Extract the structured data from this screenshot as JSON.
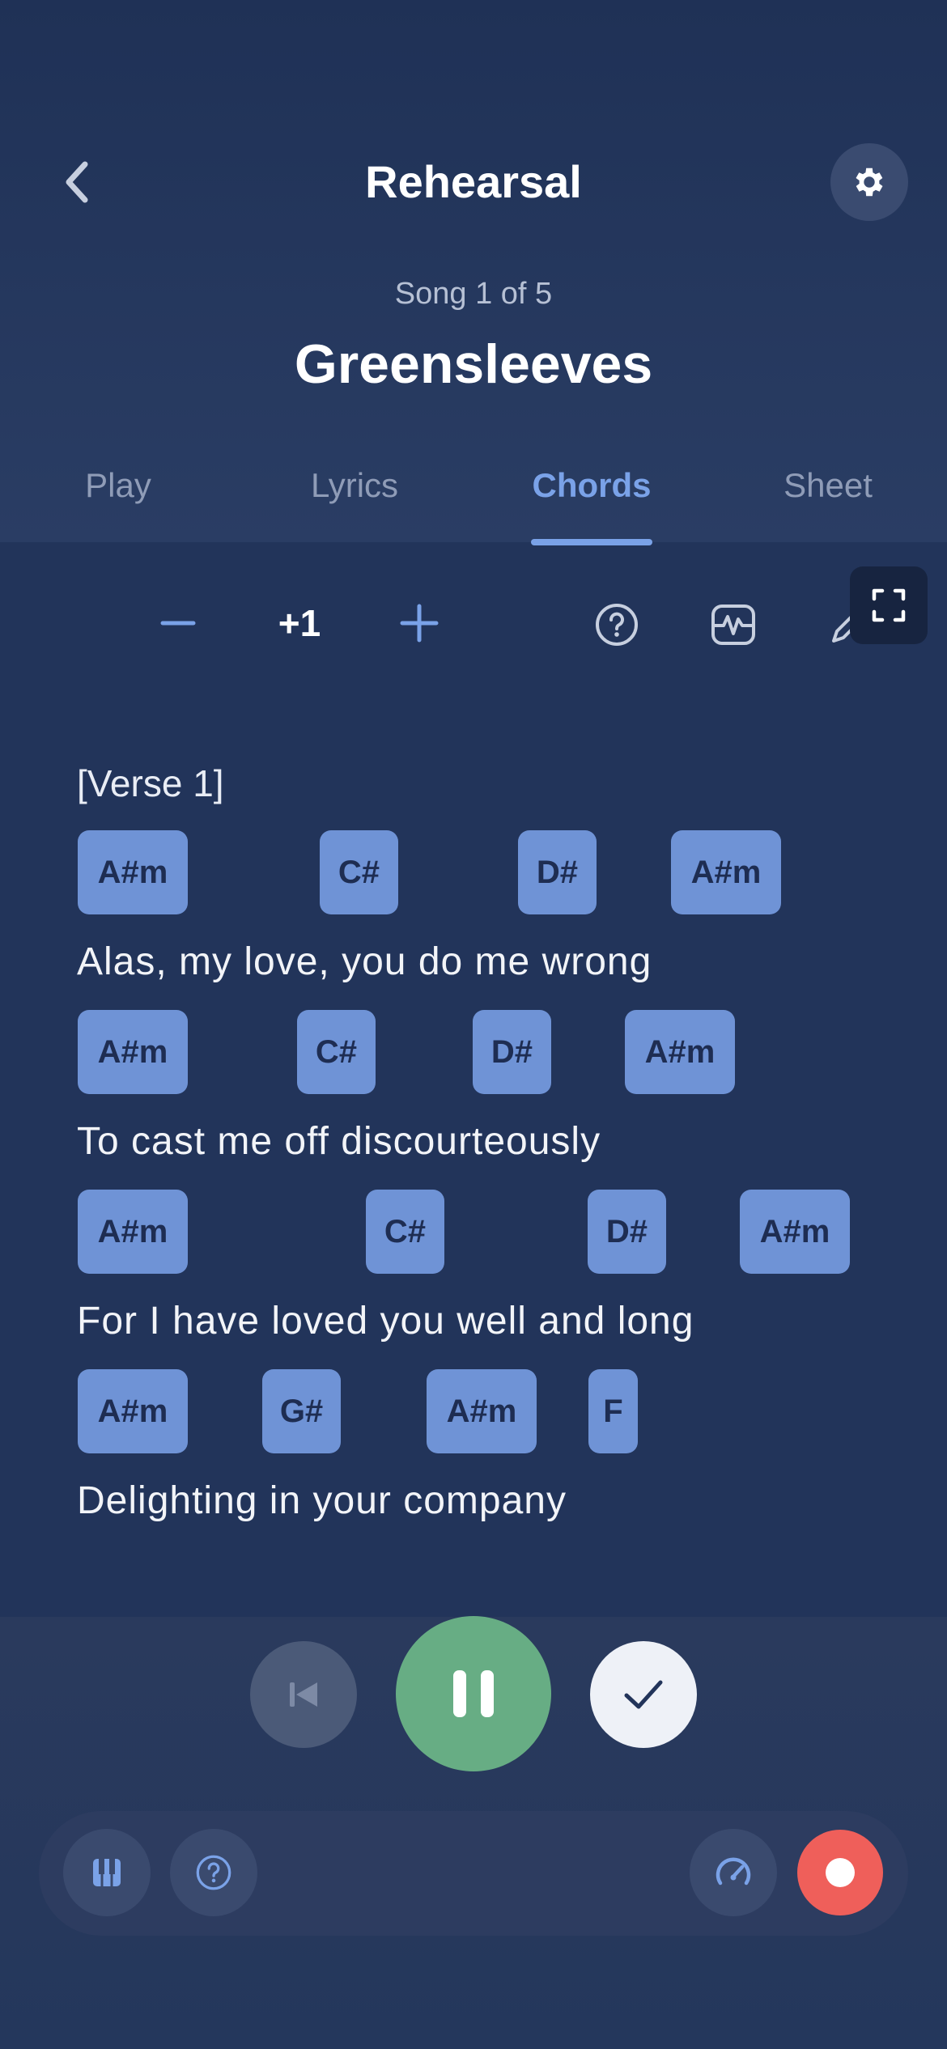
{
  "header": {
    "title": "Rehearsal",
    "song_counter": "Song 1 of 5",
    "song_title": "Greensleeves"
  },
  "tabs": [
    {
      "label": "Play",
      "active": false
    },
    {
      "label": "Lyrics",
      "active": false
    },
    {
      "label": "Chords",
      "active": true
    },
    {
      "label": "Sheet",
      "active": false
    }
  ],
  "toolbar": {
    "transpose_value": "+1",
    "icons": [
      "minus-icon",
      "plus-icon",
      "help-icon",
      "waveform-icon",
      "pencil-icon",
      "fullscreen-icon"
    ]
  },
  "song": {
    "section": "[Verse 1]",
    "lines": [
      {
        "lyric": "Alas, my love, you do me wrong",
        "chords": [
          "A#m",
          "C#",
          "D#",
          "A#m"
        ]
      },
      {
        "lyric": "To cast me off discourteously",
        "chords": [
          "A#m",
          "C#",
          "D#",
          "A#m"
        ]
      },
      {
        "lyric": "For I have loved you well and long",
        "chords": [
          "A#m",
          "C#",
          "D#",
          "A#m"
        ]
      },
      {
        "lyric": "Delighting in your company",
        "chords": [
          "A#m",
          "G#",
          "A#m",
          "F"
        ]
      }
    ]
  },
  "player": {
    "controls": [
      "skip-back-icon",
      "pause-icon",
      "check-icon"
    ],
    "bottom_icons": [
      "piano-icon",
      "help-icon",
      "speedometer-icon",
      "record-icon"
    ]
  },
  "colors": {
    "background": "#22345a",
    "accent": "#7aa2e8",
    "chord_chip": "#6f93d6",
    "pause_button": "#67ad84",
    "record": "#ef5f5a"
  }
}
